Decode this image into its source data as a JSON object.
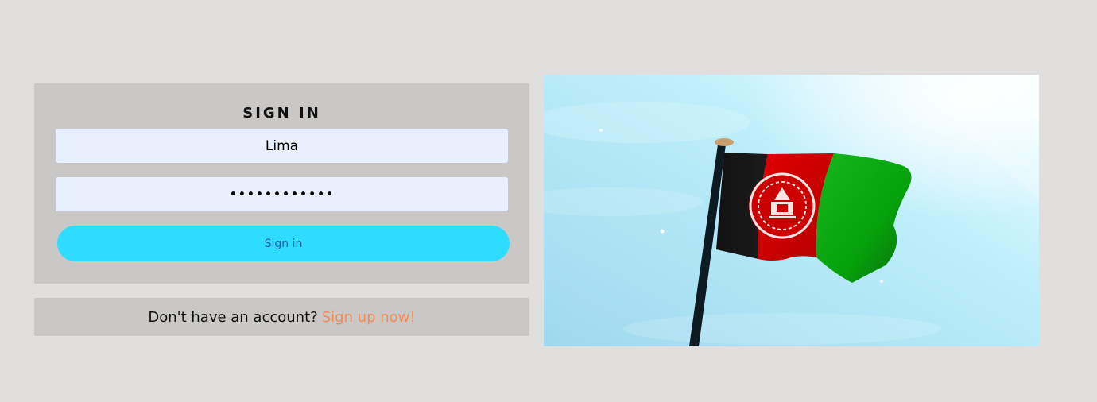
{
  "login": {
    "title": "SIGN IN",
    "username_value": "Lima",
    "password_value": "••••••••••••",
    "submit_label": "Sign in"
  },
  "signup": {
    "prompt": "Don't have an account?",
    "link_label": "Sign up now!"
  },
  "colors": {
    "background": "#e0dfdd",
    "card": "#c9c8c6",
    "input": "#e8f0fe",
    "button": "#2ddcff",
    "button_text": "#1c5fa8",
    "link": "#f58a55"
  },
  "hero_image": {
    "subject": "afghanistan-flag-icon"
  }
}
